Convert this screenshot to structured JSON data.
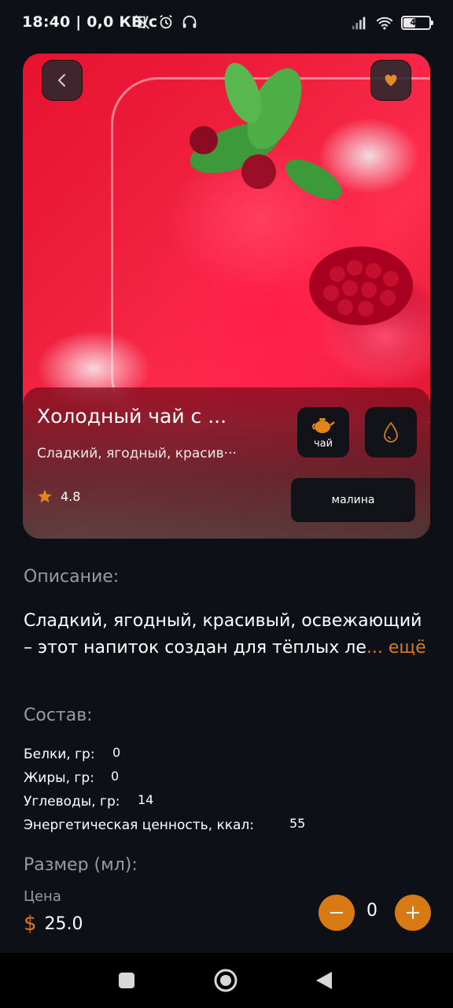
{
  "status_bar": {
    "time_net": "18:40 | 0,0 КБ/с",
    "battery": "43"
  },
  "product": {
    "name": "Холодный чай с ...",
    "subtitle": "Сладкий, ягодный, красив···",
    "rating": "4.8",
    "tag_label": "чай",
    "ingredient": "малина"
  },
  "description": {
    "title": "Описание:",
    "text": "Сладкий, ягодный, красивый, освежающий – этот напиток создан для тёплых ле",
    "ellipsis": "...",
    "more": "ещё"
  },
  "composition": {
    "title": "Состав:",
    "items": [
      {
        "label": "Белки, гр:",
        "value": "0"
      },
      {
        "label": "Жиры, гр:",
        "value": "0"
      },
      {
        "label": "Углеводы, гр:",
        "value": "14"
      },
      {
        "label": "Энергетическая ценность, ккал:",
        "value": "55"
      }
    ]
  },
  "size": {
    "title": "Размер (мл):"
  },
  "price": {
    "label": "Цена",
    "currency": "$",
    "value": "25.0"
  },
  "quantity": {
    "value": "0"
  },
  "colors": {
    "accent": "#d87a14",
    "background": "#0d1016",
    "muted": "#9a9ba0"
  }
}
